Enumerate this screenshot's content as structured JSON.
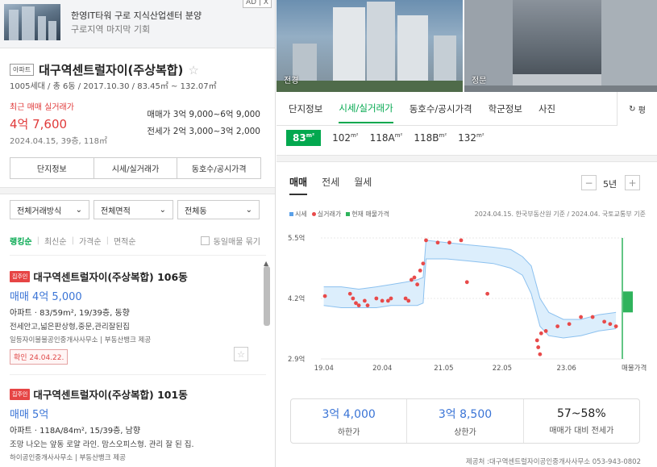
{
  "ad": {
    "title": "한영IT타워 구로 지식산업센터 분양",
    "subtitle": "구로지역 마지막 기회",
    "tag": "AD | X"
  },
  "complex": {
    "type_badge": "아파트",
    "name": "대구역센트럴자이(주상복합)",
    "info": "1005세대 / 총 6동 / 2017.10.30 / 83.45㎡ ~ 132.07㎡",
    "recent_label": "최근 매매 실거래가",
    "recent_price": "4억 7,600",
    "recent_detail": "2024.04.15, 39층, 118㎡",
    "sale_range_label": "매매가",
    "sale_range": "3억 9,000~6억 9,000",
    "jeonse_range_label": "전세가",
    "jeonse_range": "2억 3,000~3억 2,000"
  },
  "left_buttons": [
    "단지정보",
    "시세/실거래가",
    "동호수/공시가격"
  ],
  "filters": [
    "전체거래방식",
    "전체면적",
    "전체동"
  ],
  "sorts": [
    "랭킹순",
    "최신순",
    "가격순",
    "면적순"
  ],
  "same_listing_label": "동일매물 묶기",
  "listings": [
    {
      "badge": "집주인",
      "title": "대구역센트럴자이(주상복합) 106동",
      "price": "매매 4억 5,000",
      "detail": "아파트 · 83/59m², 19/39층, 동향",
      "desc": "전세안고,넓은판상형,중문,관리잘된집",
      "agency": "일등자이불불공인중개사사무소 | 부동산뱅크 제공",
      "confirmed": "확인 24.04.22."
    },
    {
      "badge": "집주인",
      "title": "대구역센트럴자이(주상복합) 101동",
      "price": "매매 5억",
      "detail": "아파트 · 118A/84m², 15/39층, 남향",
      "desc": "조망 나오는 앞동 로얄 라인. 맘스오피스형. 관리 잘 된 집.",
      "agency": "하이공인중개사사무소 | 부동산뱅크 제공"
    }
  ],
  "photos": {
    "left_label": "전경",
    "right_label": "정문"
  },
  "tabs": [
    "단지정보",
    "시세/실거래가",
    "동호수/공시가격",
    "학군정보",
    "사진"
  ],
  "refresh_label": "평",
  "areas": [
    {
      "num": "83",
      "unit": "m²",
      "label": "83㎡"
    },
    {
      "num": "102",
      "unit": "m²",
      "label": "102㎡"
    },
    {
      "num": "118A",
      "unit": "m²",
      "label": "118A㎡"
    },
    {
      "num": "118B",
      "unit": "m²",
      "label": "118B㎡"
    },
    {
      "num": "132",
      "unit": "m²",
      "label": "132㎡"
    }
  ],
  "subtabs": [
    "매매",
    "전세",
    "월세"
  ],
  "period": "5년",
  "legend": {
    "market": "시세",
    "actual": "실거래가",
    "listing": "현재 매물가격"
  },
  "source_note": "2024.04.15. 한국부동산원 기준 / 2024.04. 국토교통부 기준",
  "colors": {
    "accent": "#03a84f",
    "price_red": "#e03a3a",
    "blue": "#3a74d6",
    "band": "#dceefc"
  },
  "chart_data": {
    "type": "line",
    "x_ticks": [
      "19.04",
      "20.04",
      "21.05",
      "22.05",
      "23.06"
    ],
    "x_end_label": "매물가격",
    "y_ticks": [
      "2.9억",
      "4.2억",
      "5.5억"
    ],
    "ylim": [
      2.9,
      5.5
    ],
    "xlim": [
      2019.25,
      2024.45
    ],
    "market_band": [
      {
        "x": 2019.3,
        "low": 4.05,
        "high": 4.45
      },
      {
        "x": 2019.6,
        "low": 4.0,
        "high": 4.45
      },
      {
        "x": 2019.9,
        "low": 4.0,
        "high": 4.4
      },
      {
        "x": 2020.2,
        "low": 4.0,
        "high": 4.45
      },
      {
        "x": 2020.45,
        "low": 4.05,
        "high": 4.5
      },
      {
        "x": 2020.7,
        "low": 4.05,
        "high": 4.55
      },
      {
        "x": 2020.9,
        "low": 4.05,
        "high": 4.6
      },
      {
        "x": 2021.0,
        "low": 4.1,
        "high": 4.65
      },
      {
        "x": 2021.05,
        "low": 5.05,
        "high": 5.45
      },
      {
        "x": 2021.4,
        "low": 5.05,
        "high": 5.4
      },
      {
        "x": 2021.8,
        "low": 5.0,
        "high": 5.35
      },
      {
        "x": 2022.2,
        "low": 4.95,
        "high": 5.3
      },
      {
        "x": 2022.5,
        "low": 4.85,
        "high": 5.25
      },
      {
        "x": 2022.7,
        "low": 4.7,
        "high": 5.1
      },
      {
        "x": 2022.85,
        "low": 4.3,
        "high": 4.9
      },
      {
        "x": 2023.0,
        "low": 3.6,
        "high": 4.2
      },
      {
        "x": 2023.15,
        "low": 3.4,
        "high": 3.9
      },
      {
        "x": 2023.4,
        "low": 3.35,
        "high": 3.75
      },
      {
        "x": 2023.7,
        "low": 3.4,
        "high": 3.75
      },
      {
        "x": 2024.0,
        "low": 3.5,
        "high": 3.85
      },
      {
        "x": 2024.3,
        "low": 3.55,
        "high": 3.9
      }
    ],
    "transactions": [
      {
        "x": 2019.32,
        "y": 4.25
      },
      {
        "x": 2019.75,
        "y": 4.3
      },
      {
        "x": 2019.8,
        "y": 4.2
      },
      {
        "x": 2019.85,
        "y": 4.1
      },
      {
        "x": 2019.9,
        "y": 4.05
      },
      {
        "x": 2020.0,
        "y": 4.15
      },
      {
        "x": 2020.05,
        "y": 4.05
      },
      {
        "x": 2020.2,
        "y": 4.2
      },
      {
        "x": 2020.3,
        "y": 4.15
      },
      {
        "x": 2020.4,
        "y": 4.15
      },
      {
        "x": 2020.45,
        "y": 4.2
      },
      {
        "x": 2020.7,
        "y": 4.2
      },
      {
        "x": 2020.75,
        "y": 4.15
      },
      {
        "x": 2020.8,
        "y": 4.6
      },
      {
        "x": 2020.85,
        "y": 4.65
      },
      {
        "x": 2020.9,
        "y": 4.5
      },
      {
        "x": 2020.95,
        "y": 4.8
      },
      {
        "x": 2021.0,
        "y": 4.95
      },
      {
        "x": 2021.05,
        "y": 5.45
      },
      {
        "x": 2021.25,
        "y": 5.4
      },
      {
        "x": 2021.45,
        "y": 5.4
      },
      {
        "x": 2021.65,
        "y": 5.45
      },
      {
        "x": 2021.75,
        "y": 4.55
      },
      {
        "x": 2022.1,
        "y": 4.3
      },
      {
        "x": 2022.95,
        "y": 3.3
      },
      {
        "x": 2022.97,
        "y": 3.15
      },
      {
        "x": 2023.0,
        "y": 3.0
      },
      {
        "x": 2023.02,
        "y": 3.45
      },
      {
        "x": 2023.1,
        "y": 3.5
      },
      {
        "x": 2023.3,
        "y": 3.6
      },
      {
        "x": 2023.5,
        "y": 3.65
      },
      {
        "x": 2023.7,
        "y": 3.8
      },
      {
        "x": 2023.9,
        "y": 3.8
      },
      {
        "x": 2024.1,
        "y": 3.7
      },
      {
        "x": 2024.2,
        "y": 3.65
      },
      {
        "x": 2024.3,
        "y": 3.6
      }
    ],
    "current_listing": {
      "low": 3.9,
      "high": 4.35
    }
  },
  "summary": [
    {
      "value": "3억 4,000",
      "label": "하한가"
    },
    {
      "value": "3억 8,500",
      "label": "상한가"
    },
    {
      "value": "57~58%",
      "label": "매매가 대비 전세가"
    }
  ],
  "footer": "제공처 :대구역센트럴자이공인중개사사무소 053-943-0802"
}
